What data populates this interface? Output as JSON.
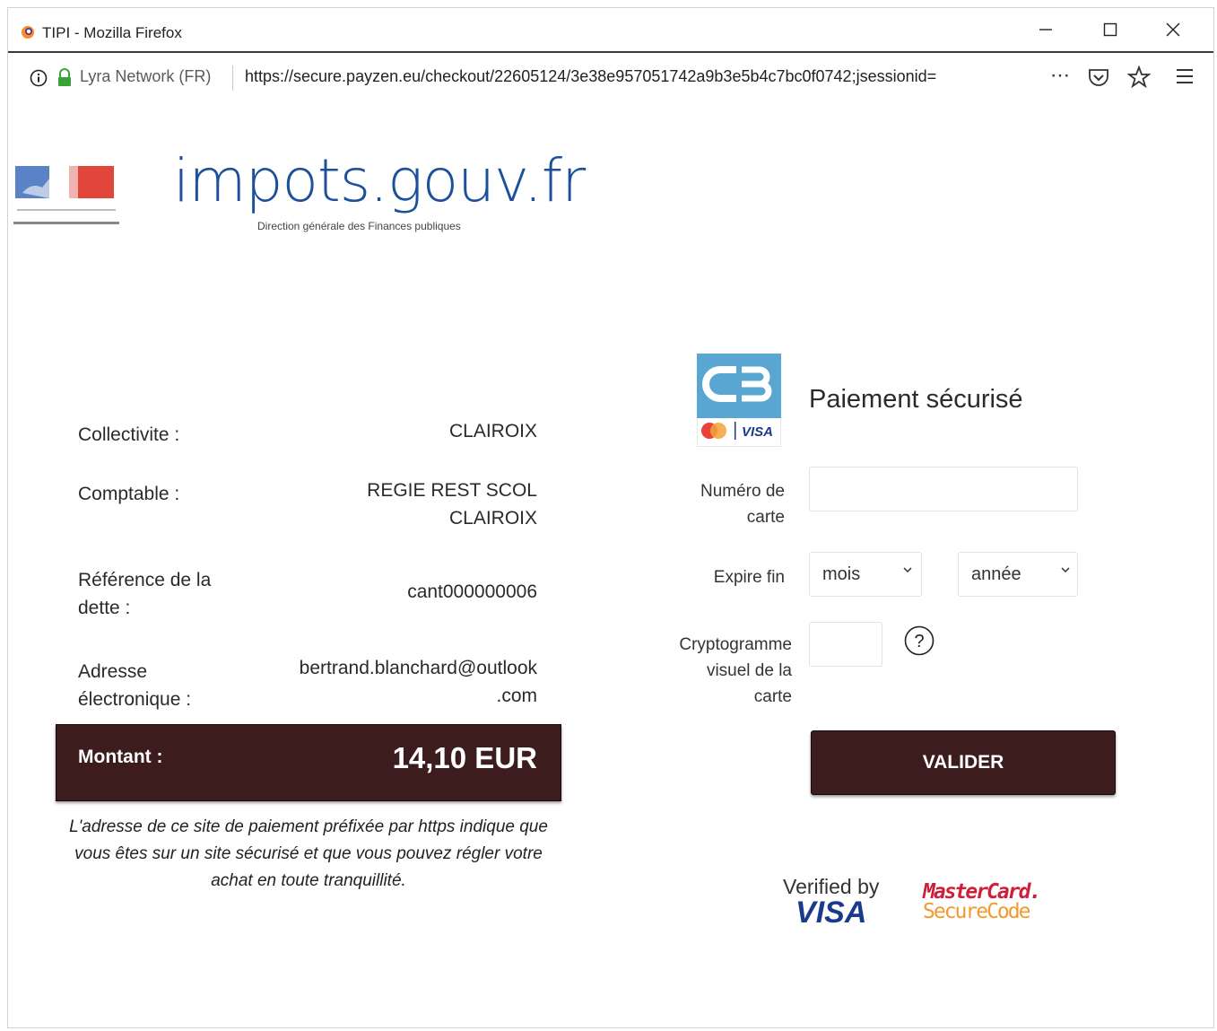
{
  "window": {
    "title": "TIPI - Mozilla Firefox"
  },
  "urlbar": {
    "site_identity": "Lyra Network (FR)",
    "url": "https://secure.payzen.eu/checkout/22605124/3e38e957051742a9b3e5b4c7bc0f0742;jsessionid="
  },
  "header": {
    "brand": "impots.gouv.fr",
    "subtitle": "Direction générale des Finances publiques"
  },
  "details": {
    "collectivite_label": "Collectivite :",
    "collectivite_value": "CLAIROIX",
    "comptable_label": "Comptable :",
    "comptable_value_line1": "REGIE REST SCOL",
    "comptable_value_line2": "CLAIROIX",
    "reference_label_line1": "Référence de la",
    "reference_label_line2": "dette :",
    "reference_value": "cant000000006",
    "adresse_label_line1": "Adresse",
    "adresse_label_line2": "électronique :",
    "adresse_value_line1": "bertrand.blanchard@outlook",
    "adresse_value_line2": ".com",
    "amount_label": "Montant :",
    "amount_value": "14,10 EUR",
    "disclaimer": "L'adresse de ce site de paiement préfixée par https indique que vous êtes sur un site sécurisé et que vous pouvez régler votre achat en toute tranquillité."
  },
  "payment": {
    "title": "Paiement sécurisé",
    "card_logo_text": "VISA",
    "card_number_label_line1": "Numéro de",
    "card_number_label_line2": "carte",
    "card_number_value": "",
    "expiry_label": "Expire fin",
    "month_selected": "mois",
    "year_selected": "année",
    "cvv_label_line1": "Cryptogramme",
    "cvv_label_line2": "visuel de la",
    "cvv_label_line3": "carte",
    "cvv_value": "",
    "help_symbol": "?",
    "submit_label": "VALIDER",
    "verified_by": "Verified by",
    "verified_visa": "VISA",
    "mastercard_line1": "MasterCard.",
    "mastercard_line2": "SecureCode"
  },
  "icons": [
    "firefox-icon",
    "minimize-icon",
    "maximize-icon",
    "close-icon",
    "info-icon",
    "lock-icon",
    "more-icon",
    "pocket-icon",
    "bookmark-star-icon",
    "hamburger-menu-icon",
    "marianne-logo",
    "cb-card-logo",
    "help-icon"
  ],
  "colors": {
    "brand_blue": "#1c4f9c",
    "dark_button": "#3c1c1c",
    "mastercard_red": "#d01e3a",
    "mastercard_orange": "#f29a2e",
    "visa_blue": "#1a3b8c"
  }
}
